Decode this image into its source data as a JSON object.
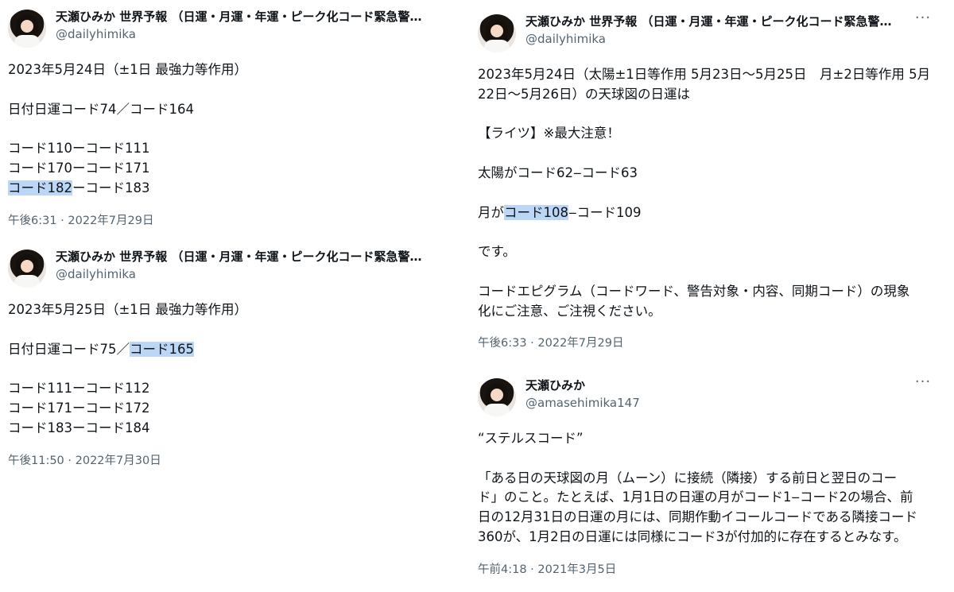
{
  "tweets": [
    {
      "name": "天瀬ひみか 世界予報 （日運・月運・年運・ピーク化コード緊急警…",
      "handle": "@dailyhimika",
      "lines": [
        {
          "pre": "2023年5月24日（±1日 最強力等作用）"
        },
        {
          "pre": ""
        },
        {
          "pre": "日付日運コード74／コード164"
        },
        {
          "pre": ""
        },
        {
          "pre": "コード110ーコード111"
        },
        {
          "pre": "コード170ーコード171"
        },
        {
          "pre": "",
          "hl": "コード182",
          "post": "ーコード183"
        }
      ],
      "meta": "午後6:31 · 2022年7月29日"
    },
    {
      "name": "天瀬ひみか 世界予報 （日運・月運・年運・ピーク化コード緊急警…",
      "handle": "@dailyhimika",
      "lines": [
        {
          "pre": "2023年5月25日（±1日 最強力等作用）"
        },
        {
          "pre": ""
        },
        {
          "pre": "日付日運コード75／",
          "hl": "コード165",
          "post": ""
        },
        {
          "pre": ""
        },
        {
          "pre": "コード111ーコード112"
        },
        {
          "pre": "コード171ーコード172"
        },
        {
          "pre": "コード183ーコード184"
        }
      ],
      "meta": "午後11:50 · 2022年7月30日"
    },
    {
      "name": "天瀬ひみか 世界予報 （日運・月運・年運・ピーク化コード緊急警…",
      "handle": "@dailyhimika",
      "more": "···",
      "lines": [
        {
          "pre": "2023年5月24日（太陽±1日等作用 5月23日〜5月25日　月±2日等作用 5月"
        },
        {
          "pre": "22日〜5月26日）の天球図の日運は"
        },
        {
          "pre": ""
        },
        {
          "pre": "【ライツ】※最大注意！"
        },
        {
          "pre": ""
        },
        {
          "pre": "太陽がコード62‒コード63"
        },
        {
          "pre": ""
        },
        {
          "pre": "月が",
          "hl": "コード108",
          "post": "‒コード109"
        },
        {
          "pre": ""
        },
        {
          "pre": "です。"
        },
        {
          "pre": ""
        },
        {
          "pre": "コードエピグラム（コードワード、警告対象・内容、同期コード）の現象"
        },
        {
          "pre": "化にご注意、ご注視ください。"
        }
      ],
      "meta": "午後6:33 · 2022年7月29日"
    },
    {
      "name": "天瀬ひみか",
      "handle": "@amasehimika147",
      "more": "···",
      "lines": [
        {
          "pre": "“ステルスコード”"
        },
        {
          "pre": ""
        },
        {
          "pre": "「ある日の天球図の月（ムーン）に接続（隣接）する前日と翌日のコー"
        },
        {
          "pre": "ド」のこと。たとえば、1月1日の日運の月がコード1‒コード2の場合、前"
        },
        {
          "pre": "日の12月31日の日運の月には、同期作動イコールコードである隣接コード"
        },
        {
          "pre": "360が、1月2日の日運には同様にコード3が付加的に存在するとみなす。"
        }
      ],
      "meta": "午前4:18 · 2021年3月5日"
    }
  ]
}
